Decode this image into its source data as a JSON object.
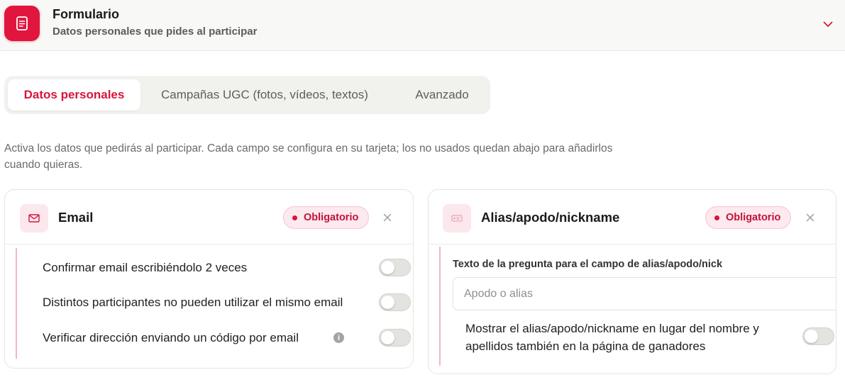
{
  "header": {
    "icon": "form-document-icon",
    "title": "Formulario",
    "subtitle": "Datos personales que pides al participar",
    "chevron_icon": "chevron-down-icon"
  },
  "tabs": [
    {
      "label": "Datos personales",
      "active": true
    },
    {
      "label": "Campañas UGC (fotos, vídeos, textos)",
      "active": false
    },
    {
      "label": "Avanzado",
      "active": false
    }
  ],
  "intro": "Activa los datos que pedirás al participar. Cada campo se configura en su tarjeta; los no usados quedan abajo para añadirlos cuando quieras.",
  "cards": {
    "email": {
      "icon": "envelope-icon",
      "title": "Email",
      "badge": "Obligatorio",
      "options": [
        {
          "label": "Confirmar email escribiéndolo 2 veces",
          "enabled": false
        },
        {
          "label": "Distintos participantes no pueden utilizar el mismo email",
          "enabled": false
        },
        {
          "label": "Verificar dirección enviando un código por email",
          "enabled": false,
          "info_icon": "info-icon",
          "info_glyph": "i"
        }
      ]
    },
    "alias": {
      "icon": "id-tag-icon",
      "title": "Alias/apodo/nickname",
      "badge": "Obligatorio",
      "question_label": "Texto de la pregunta para el campo de alias/apodo/nick",
      "question_value": "",
      "question_placeholder": "Apodo o alias",
      "show_option": {
        "label": "Mostrar el alias/apodo/nickname en lugar del nombre y apellidos también en la página de ganadores",
        "enabled": false
      }
    }
  },
  "colors": {
    "brand": "#e0163f",
    "badge_bg": "#fde9ee",
    "accent_line": "#f0b8c5"
  }
}
